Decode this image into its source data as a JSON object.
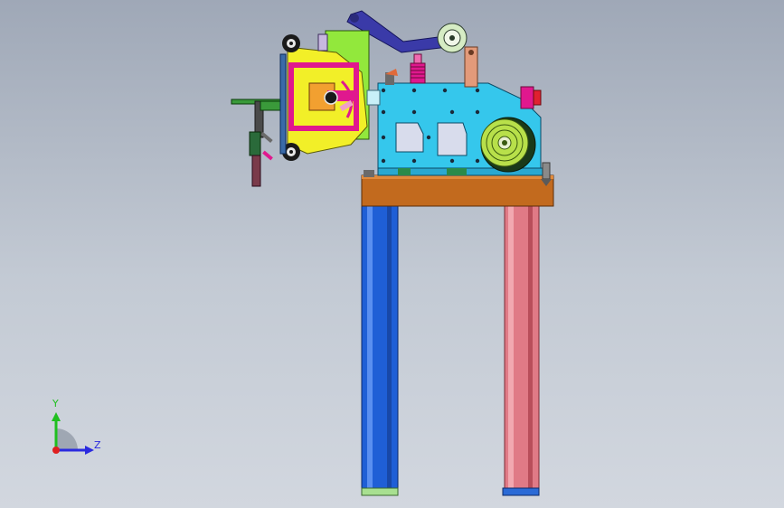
{
  "viewport": {
    "background_top": "#9fa8b7",
    "background_bottom": "#d2d7df"
  },
  "triad": {
    "y_label": "Y",
    "z_label": "Z",
    "y_color": "#1fbf1f",
    "z_color": "#2a2adf",
    "x_color": "#df1f1f"
  },
  "parts": {
    "left_column_color": "#1f5fd6",
    "right_column_color": "#e07a86",
    "table_color": "#c26a1e",
    "gearbox_color": "#35c7ec",
    "bracket_color": "#f2ef28",
    "magenta_color": "#e0188e",
    "plate_green_color": "#92e83c",
    "arm_color": "#3a3aa8",
    "wheel_color": "#b8e04a"
  }
}
